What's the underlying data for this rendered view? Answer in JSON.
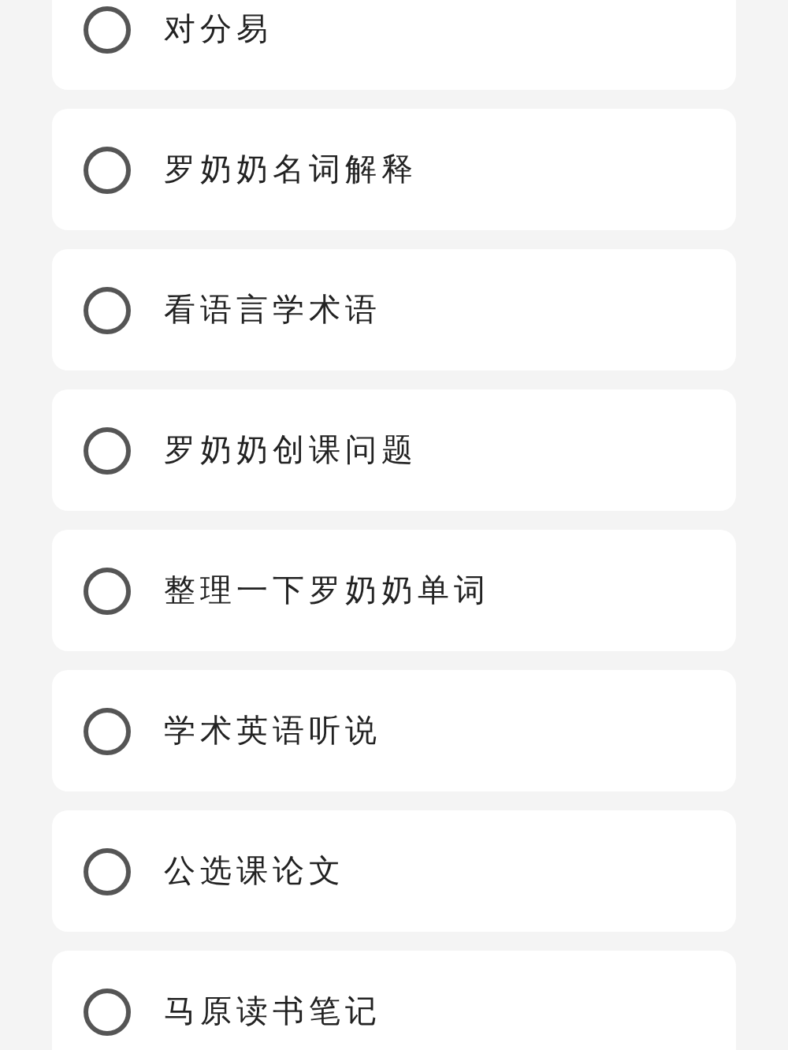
{
  "tasks": [
    {
      "label": "对分易",
      "checked": false
    },
    {
      "label": "罗奶奶名词解释",
      "checked": false
    },
    {
      "label": "看语言学术语",
      "checked": false
    },
    {
      "label": "罗奶奶创课问题",
      "checked": false
    },
    {
      "label": "整理一下罗奶奶单词",
      "checked": false
    },
    {
      "label": "学术英语听说",
      "checked": false
    },
    {
      "label": "公选课论文",
      "checked": false
    },
    {
      "label": "马原读书笔记",
      "checked": false
    }
  ]
}
